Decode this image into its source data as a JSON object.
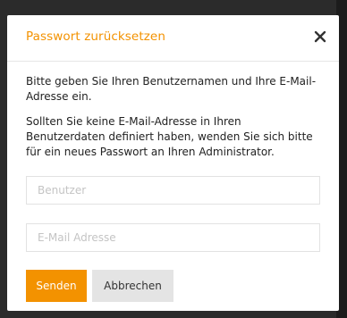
{
  "dialog": {
    "title": "Passwort zurücksetzen",
    "close_icon": "close-icon",
    "paragraphs": [
      "Bitte geben Sie Ihren Benutzernamen und Ihre E-Mail-Adresse ein.",
      "Sollten Sie keine E-Mail-Adresse in Ihren Benutzerdaten definiert haben, wenden Sie sich bitte für ein neues Passwort an Ihren Administrator."
    ],
    "fields": {
      "username": {
        "placeholder": "Benutzer",
        "value": ""
      },
      "email": {
        "placeholder": "E-Mail Adresse",
        "value": ""
      }
    },
    "buttons": {
      "send": "Senden",
      "cancel": "Abbrechen"
    }
  },
  "colors": {
    "accent": "#f39200",
    "secondary_button": "#e4e4e4",
    "backdrop": "#2b2b2b"
  }
}
